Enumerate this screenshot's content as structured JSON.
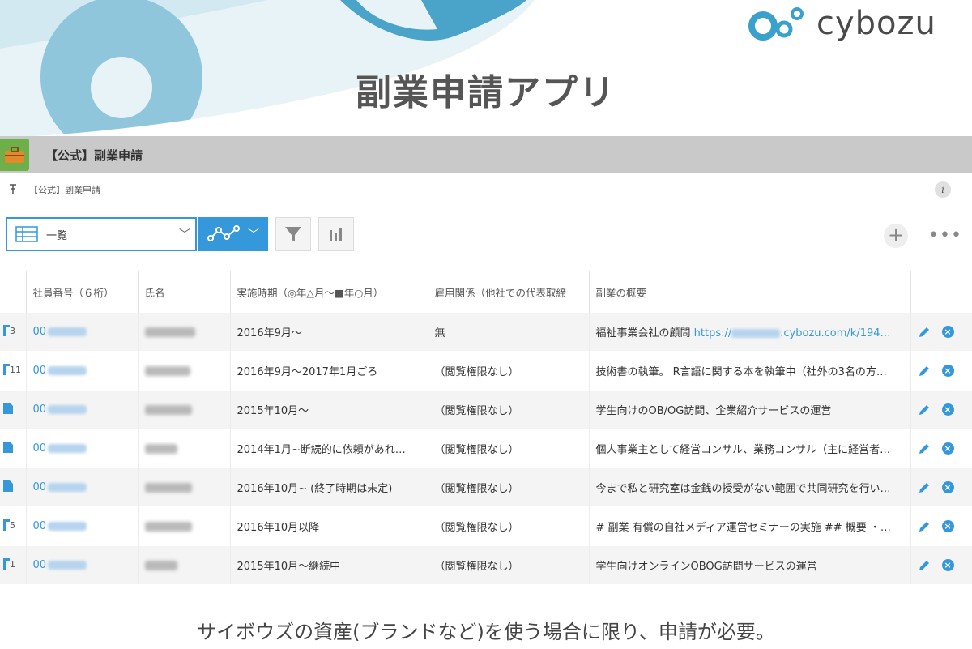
{
  "brand": {
    "logo_text": "cybozu",
    "accent": "#3498db",
    "app_color": "#6db04a"
  },
  "hero": {
    "title": "副業申請アプリ"
  },
  "app": {
    "name": "【公式】副業申請",
    "breadcrumb": "【公式】副業申請"
  },
  "toolbar": {
    "view_label": "一覧",
    "icons": [
      "table-icon",
      "graph-icon",
      "filter-icon",
      "bar-chart-icon",
      "plus-icon",
      "more-icon",
      "info-icon"
    ]
  },
  "table": {
    "headers": [
      "",
      "社員番号（６桁）",
      "氏名",
      "実施時期（◎年△月〜■年○月）",
      "雇用関係（他社での代表取締",
      "副業の概要",
      ""
    ],
    "rows": [
      {
        "comments": "3",
        "emp_no": "00",
        "period": "2016年9月〜",
        "employment": "無",
        "summary": "福祉事業会社の顧問",
        "summary_url_prefix": "https://",
        "summary_url_suffix": ".cybozu.com/k/194…"
      },
      {
        "comments": "11",
        "emp_no": "00",
        "period": "2016年9月〜2017年1月ごろ",
        "employment": "（閲覧権限なし）",
        "summary": "技術書の執筆。 R言語に関する本を執筆中（社外の3名の方…"
      },
      {
        "comments": "",
        "emp_no": "00",
        "period": "2015年10月〜",
        "employment": "（閲覧権限なし）",
        "summary": "学生向けのOB/OG訪問、企業紹介サービスの運営"
      },
      {
        "comments": "",
        "emp_no": "00",
        "period": "2014年1月~断続的に依頼があれ…",
        "employment": "（閲覧権限なし）",
        "summary": "個人事業主として経営コンサル、業務コンサル（主に経営者…"
      },
      {
        "comments": "",
        "emp_no": "00",
        "period": "2016年10月~ (終了時期は未定)",
        "employment": "（閲覧権限なし）",
        "summary": "今まで私と研究室は金銭の授受がない範囲で共同研究を行い…"
      },
      {
        "comments": "5",
        "emp_no": "00",
        "period": "2016年10月以降",
        "employment": "（閲覧権限なし）",
        "summary": "# 副業 有償の自社メディア運営セミナーの実施 ## 概要 ・…"
      },
      {
        "comments": "1",
        "emp_no": "00",
        "period": "2015年10月〜継続中",
        "employment": "（閲覧権限なし）",
        "summary": "学生向けオンラインOBOG訪問サービスの運営"
      }
    ]
  },
  "caption": "サイボウズの資産(ブランドなど)を使う場合に限り、申請が必要。"
}
